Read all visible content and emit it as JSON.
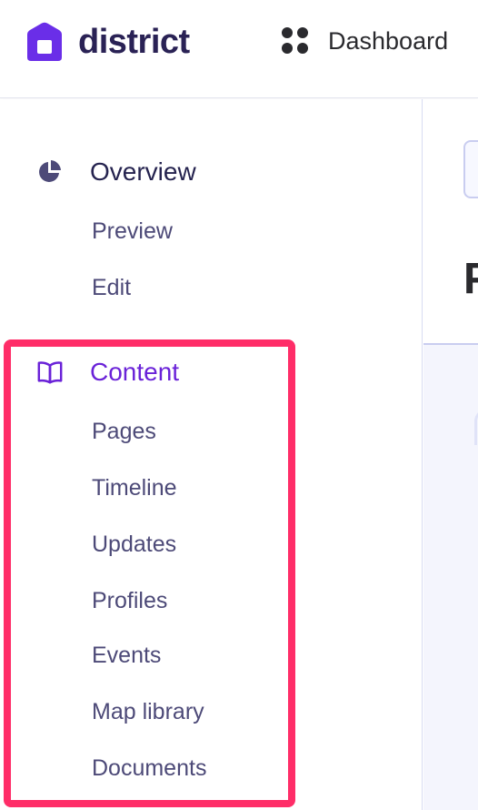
{
  "header": {
    "logo_text": "district",
    "logo_icon": "house-icon",
    "dashboard_label": "Dashboard",
    "dashboard_icon": "dots-grid-icon"
  },
  "sidebar": {
    "overview": {
      "label": "Overview",
      "icon": "pie-chart-icon",
      "items": [
        "Preview",
        "Edit"
      ]
    },
    "content": {
      "label": "Content",
      "icon": "book-open-icon",
      "items": [
        "Pages",
        "Timeline",
        "Updates",
        "Profiles",
        "Events",
        "Map library",
        "Documents"
      ]
    }
  },
  "right_panel": {
    "title_fragment": "P"
  },
  "colors": {
    "brand": "#6a2ee8",
    "active": "#6a22d8",
    "highlight": "#ff2d68",
    "text": "#4d4a78"
  }
}
